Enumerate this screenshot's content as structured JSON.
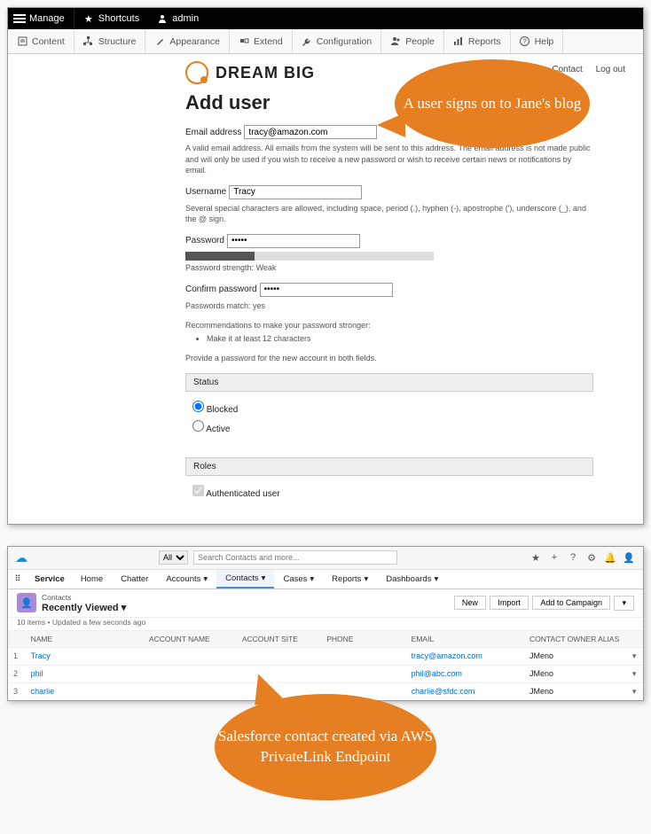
{
  "drupal": {
    "adminbar": {
      "manage": "Manage",
      "shortcuts": "Shortcuts",
      "user": "admin"
    },
    "subbar": [
      "Content",
      "Structure",
      "Appearance",
      "Extend",
      "Configuration",
      "People",
      "Reports",
      "Help"
    ],
    "site_title": "DREAM BIG",
    "header_links": {
      "contact": "Contact",
      "logout": "Log out"
    },
    "page_title": "Add user",
    "email": {
      "label": "Email address",
      "value": "tracy@amazon.com",
      "help": "A valid email address. All emails from the system will be sent to this address. The email address is not made public and will only be used if you wish to receive a new password or wish to receive certain news or notifications by email."
    },
    "username": {
      "label": "Username",
      "value": "Tracy",
      "help": "Several special characters are allowed, including space, period (.), hyphen (-), apostrophe ('), underscore (_), and the @ sign."
    },
    "password": {
      "label": "Password",
      "strength_label": "Password strength:",
      "strength_value": "Weak"
    },
    "confirm": {
      "label": "Confirm password",
      "match_label": "Passwords match:",
      "match_value": "yes"
    },
    "recs": {
      "title": "Recommendations to make your password stronger:",
      "items": [
        "Make it at least 12 characters"
      ]
    },
    "provide": "Provide a password for the new account in both fields.",
    "status": {
      "header": "Status",
      "blocked": "Blocked",
      "active": "Active"
    },
    "roles": {
      "header": "Roles",
      "auth": "Authenticated user"
    }
  },
  "callouts": {
    "top": "A user signs on to Jane's blog",
    "bottom": "Salesforce contact created via AWS PrivateLink Endpoint"
  },
  "sf": {
    "search": {
      "scope": "All",
      "placeholder": "Search Contacts and more..."
    },
    "service": "Service",
    "nav": [
      "Home",
      "Chatter",
      "Accounts",
      "Contacts",
      "Cases",
      "Reports",
      "Dashboards"
    ],
    "object": "Contacts",
    "list_title": "Recently Viewed",
    "meta": "10 items • Updated a few seconds ago",
    "buttons": {
      "new": "New",
      "import": "Import",
      "campaign": "Add to Campaign"
    },
    "cols": {
      "name": "NAME",
      "account": "ACCOUNT NAME",
      "site": "ACCOUNT SITE",
      "phone": "PHONE",
      "email": "EMAIL",
      "owner": "CONTACT OWNER ALIAS"
    },
    "rows": [
      {
        "n": "1",
        "name": "Tracy",
        "email": "tracy@amazon.com",
        "owner": "JMeno"
      },
      {
        "n": "2",
        "name": "phil",
        "email": "phil@abc.com",
        "owner": "JMeno"
      },
      {
        "n": "3",
        "name": "charlie",
        "email": "charlie@sfdc.com",
        "owner": "JMeno"
      }
    ]
  }
}
